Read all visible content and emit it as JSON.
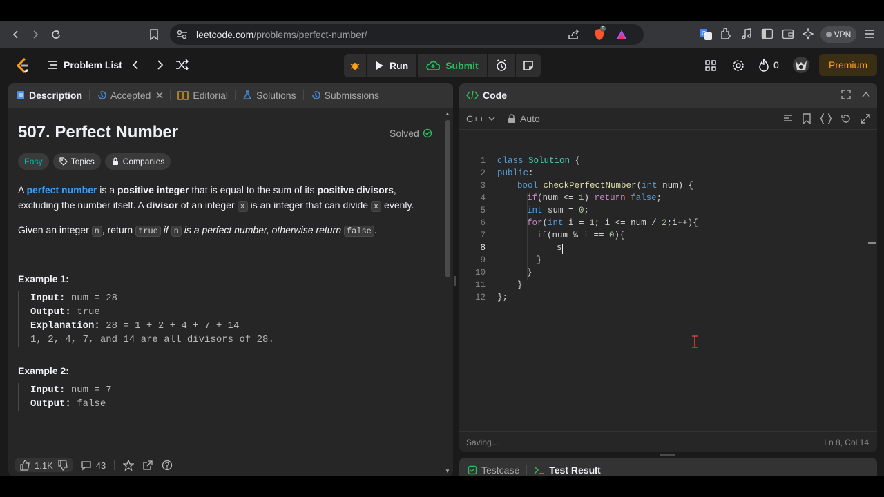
{
  "browser": {
    "url_host": "leetcode.com",
    "url_path": "/problems/perfect-number/",
    "vpn_label": "VPN",
    "brave_badge": "5"
  },
  "nav": {
    "problem_list": "Problem List",
    "run": "Run",
    "submit": "Submit",
    "streak_count": "0",
    "premium": "Premium"
  },
  "left_tabs": [
    "Description",
    "Accepted",
    "Editorial",
    "Solutions",
    "Submissions"
  ],
  "problem": {
    "title": "507. Perfect Number",
    "status": "Solved",
    "difficulty": "Easy",
    "topics": "Topics",
    "companies": "Companies",
    "p1": {
      "a": "A ",
      "link": "perfect number",
      "b": " is a ",
      "pos_int": "positive integer",
      "c": " that is equal to the sum of its ",
      "pos_div": "positive divisors",
      "d": ", excluding the number itself. A ",
      "divisor": "divisor",
      "e": " of an integer ",
      "x1": "x",
      "f": " is an integer that can divide ",
      "x2": "x",
      "g": " evenly."
    },
    "p2": {
      "a": "Given an integer ",
      "n1": "n",
      "b": ", return ",
      "true": "true",
      "if": "if",
      "n2": "n",
      "c": " is a perfect number, otherwise return ",
      "false": "false",
      "d": "."
    },
    "examples": [
      {
        "title": "Example 1:",
        "input_label": "Input:",
        "input": "num = 28",
        "output_label": "Output:",
        "output": "true",
        "expl_label": "Explanation:",
        "expl": "28 = 1 + 2 + 4 + 7 + 14",
        "expl2": "1, 2, 4, 7, and 14 are all divisors of 28."
      },
      {
        "title": "Example 2:",
        "input_label": "Input:",
        "input": "num = 7",
        "output_label": "Output:",
        "output": "false"
      }
    ],
    "likes": "1.1K",
    "comments": "43"
  },
  "code_panel": {
    "title": "Code",
    "language": "C++",
    "auto": "Auto",
    "saving": "Saving...",
    "cursor_pos": "Ln 8, Col 14",
    "line_numbers": [
      "1",
      "2",
      "3",
      "4",
      "5",
      "6",
      "7",
      "8",
      "9",
      "10",
      "11",
      "12"
    ]
  },
  "bottom_tabs": {
    "testcase": "Testcase",
    "test_result": "Test Result"
  }
}
